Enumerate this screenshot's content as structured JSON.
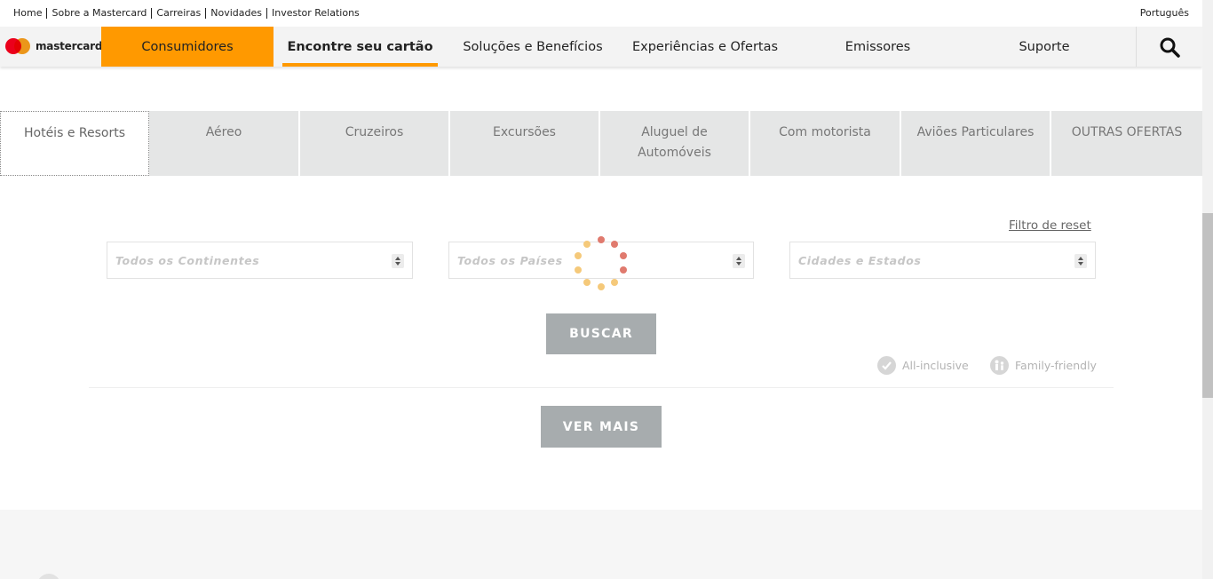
{
  "util": {
    "links": [
      "Home",
      "Sobre a Mastercard",
      "Carreiras",
      "Novidades",
      "Investor Relations"
    ],
    "language": "Português"
  },
  "brand": {
    "logo_text": "mastercard",
    "colors": {
      "red": "#eb001b",
      "orange": "#f79e1b",
      "accent": "#ff9900"
    }
  },
  "nav": {
    "items": [
      "Consumidores",
      "Encontre seu cartão",
      "Soluções e Benefícios",
      "Experiências e Ofertas",
      "Emissores",
      "Suporte"
    ],
    "active": "Consumidores",
    "current": "Encontre seu cartão",
    "search_icon": "search-icon"
  },
  "tabs": [
    {
      "label": "Hotéis e Resorts",
      "selected": true
    },
    {
      "label": "Aéreo"
    },
    {
      "label": "Cruzeiros"
    },
    {
      "label": "Excursões"
    },
    {
      "label": "Aluguel de Automóveis"
    },
    {
      "label": "Com motorista"
    },
    {
      "label": "Aviões Particulares"
    },
    {
      "label": "OUTRAS OFERTAS"
    }
  ],
  "filters": {
    "reset_label": "Filtro de reset",
    "continents_placeholder": "Todos os Continentes",
    "countries_placeholder": "Todos os Países",
    "cities_placeholder": "Cidades e Estados"
  },
  "actions": {
    "search_label": "BUSCAR",
    "more_label": "VER MAIS"
  },
  "legend": {
    "all_inclusive": "All-inclusive",
    "family_friendly": "Family-friendly"
  }
}
